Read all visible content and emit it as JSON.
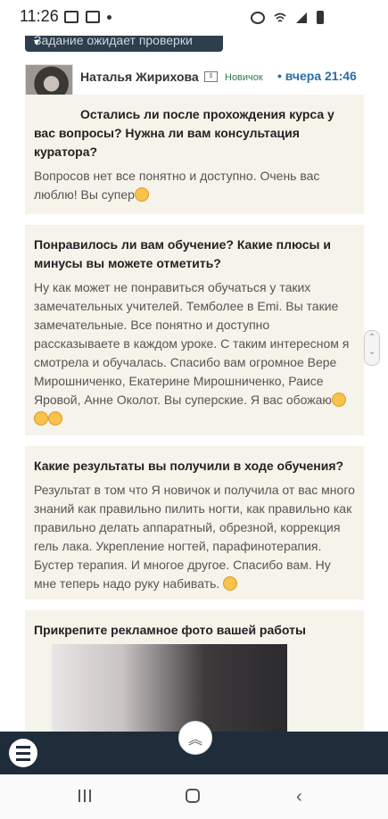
{
  "status_bar": {
    "time": "11:26"
  },
  "banner": {
    "text": "Задание ожидает проверки"
  },
  "author": {
    "name": "Наталья Жирихова",
    "rank": "Новичок",
    "separator": "•",
    "timestamp": "вчера 21:46"
  },
  "qa": [
    {
      "question": "Остались ли после прохождения курса у вас вопросы? Нужна ли вам консультация куратора?",
      "answer": "Вопросов нет все понятно и доступно. Очень вас люблю! Вы супер"
    },
    {
      "question": "Понравилось ли вам обучение? Какие плюсы и минусы вы можете отметить?",
      "answer": "Ну как может не понравиться обучаться у таких замечательных учителей. Темболее в Emi. Вы такие замечательные. Все понятно и доступно рассказываете в каждом уроке. С таким интересном я смотрела и обучалась. Спасибо вам огромное Вере Мирошниченко, Екатерине Мирошниченко, Раисе Яровой, Анне Околот. Вы суперские. Я вас обожаю"
    },
    {
      "question": "Какие результаты вы получили в ходе обучения?",
      "answer": "Результат в том что Я новичок и получила от вас много знаний как правильно пилить ногти, как правильно как правильно делать аппаратный, обрезной, коррекция гель лака. Укрепление ногтей, парафинотерапия. Бустер терапия. И многое другое. Спасибо вам. Ну мне теперь надо руку набивать."
    },
    {
      "question": "Прикрепите рекламное фото вашей работы"
    }
  ],
  "icons": {
    "menu": "hamburger-icon",
    "scroll_top": "chevron-up-icon",
    "back": "back-icon"
  }
}
